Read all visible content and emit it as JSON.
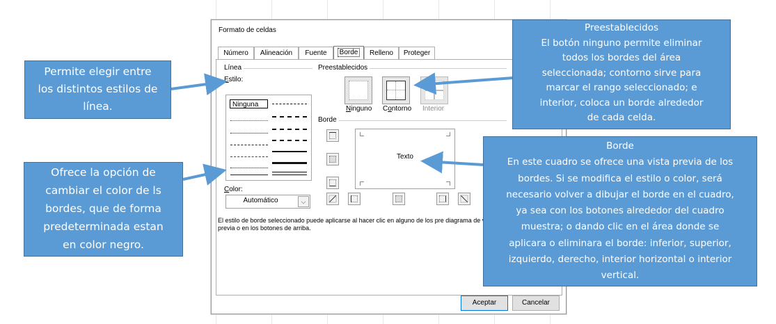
{
  "dialog": {
    "title": "Formato de celdas",
    "tabs": [
      "Número",
      "Alineación",
      "Fuente",
      "Borde",
      "Relleno",
      "Proteger"
    ],
    "active_tab": "Borde",
    "linea": {
      "group_label": "Línea",
      "estilo_label": "Estilo:",
      "ninguna": "Ninguna",
      "color_label": "Color:",
      "color_value": "Automático"
    },
    "preestablecidos": {
      "group_label": "Preestablecidos",
      "buttons": [
        "Ninguno",
        "Contorno",
        "Interior"
      ]
    },
    "borde": {
      "group_label": "Borde",
      "preview_text": "Texto"
    },
    "info": "El estilo de borde seleccionado puede aplicarse al hacer clic en alguno de los pre diagrama de vista previa o en los botones de arriba.",
    "buttons": {
      "accept": "Aceptar",
      "cancel": "Cancelar"
    }
  },
  "callouts": {
    "estilo": [
      "Permite elegir entre",
      "los distintos estilos de",
      "línea."
    ],
    "color": [
      "Ofrece la opción de",
      "cambiar el color de ls",
      "bordes, que de forma",
      "predeterminada estan",
      "en color negro."
    ],
    "preestablecidos": [
      "Preestablecidos",
      "El botón ninguno permite eliminar",
      "todos los bordes del área",
      "seleccionada; contorno sirve para",
      "marcar el rango seleccionado; e",
      "interior, coloca un borde alrededor",
      "de cada celda."
    ],
    "borde": [
      "Borde",
      "En este cuadro se ofrece una vista previa de los",
      "bordes. Si se modifica el estilo o color, será",
      "necesario volver a dibujar el borde en el cuadro,",
      "ya sea con los botones alrededor del cuadro",
      "muestra; o dando clic en el área donde se",
      "aplicara o eliminara el borde: inferior, superior,",
      "izquierdo, derecho, interior horizontal o interior",
      "vertical."
    ]
  },
  "colors": {
    "callout_fill": "#5b9bd5",
    "callout_border": "#41719c",
    "arrow": "#5b9bd5",
    "text_white": "#ffffff"
  },
  "icons": [
    "ninguno-preset-icon",
    "contorno-preset-icon",
    "interior-preset-icon",
    "border-top-icon",
    "border-inner-horizontal-icon",
    "border-bottom-icon",
    "border-diagonal-up-icon",
    "border-left-icon",
    "border-inner-vertical-icon",
    "border-right-icon",
    "border-diagonal-down-icon",
    "dropdown-arrow-icon"
  ]
}
